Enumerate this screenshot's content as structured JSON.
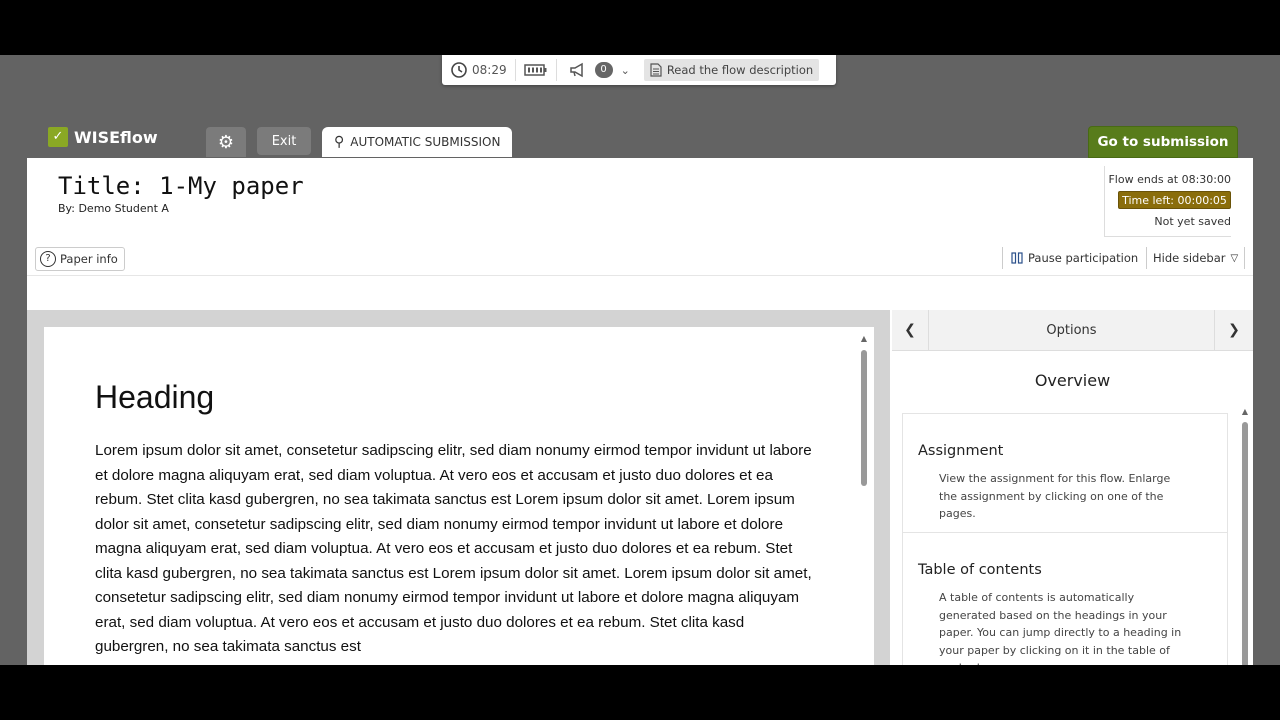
{
  "toolbar": {
    "clock": "08:29",
    "notification_count": "0",
    "read_description": "Read the flow description"
  },
  "header": {
    "logo": "WISEflow",
    "exit": "Exit",
    "automatic_submission": "AUTOMATIC SUBMISSION",
    "go_to_submission": "Go to submission"
  },
  "paper": {
    "title": "Title: 1-My paper",
    "byline": "By: Demo Student A"
  },
  "timer": {
    "flow_ends": "Flow ends at 08:30:00",
    "time_left": "Time left:  00:00:05",
    "save_status": "Not yet saved"
  },
  "actions": {
    "paper_info": "Paper info",
    "pause": "Pause participation",
    "hide_sidebar": "Hide sidebar"
  },
  "editor": {
    "heading": "Heading",
    "body": "Lorem ipsum dolor sit amet, consetetur sadipscing elitr, sed diam nonumy eirmod tempor invidunt ut labore et dolore magna aliquyam erat, sed diam voluptua. At vero eos et accusam et justo duo dolores et ea rebum. Stet clita kasd gubergren, no sea takimata sanctus est Lorem ipsum dolor sit amet. Lorem ipsum dolor sit amet, consetetur sadipscing elitr, sed diam nonumy eirmod tempor invidunt ut labore et dolore magna aliquyam erat, sed diam voluptua. At vero eos et accusam et justo duo dolores et ea rebum. Stet clita kasd gubergren, no sea takimata sanctus est Lorem ipsum dolor sit amet. Lorem ipsum dolor sit amet, consetetur sadipscing elitr, sed diam nonumy eirmod tempor invidunt ut labore et dolore magna aliquyam erat, sed diam voluptua. At vero eos et accusam et justo duo dolores et ea rebum. Stet clita kasd gubergren, no sea takimata sanctus est"
  },
  "sidebar": {
    "title": "Options",
    "overview": "Overview",
    "cards": [
      {
        "title": "Assignment",
        "text": "View the assignment for this flow. Enlarge the assignment by clicking on one of the pages."
      },
      {
        "title": "Table of contents",
        "text": "A table of contents is automatically generated based on the headings in your paper. You can jump directly to a heading in your paper by clicking on it in the table of contents."
      }
    ]
  },
  "colors": {
    "brand_green": "#587c1b",
    "timer_badge": "#8a6d0b",
    "background": "#636363"
  }
}
